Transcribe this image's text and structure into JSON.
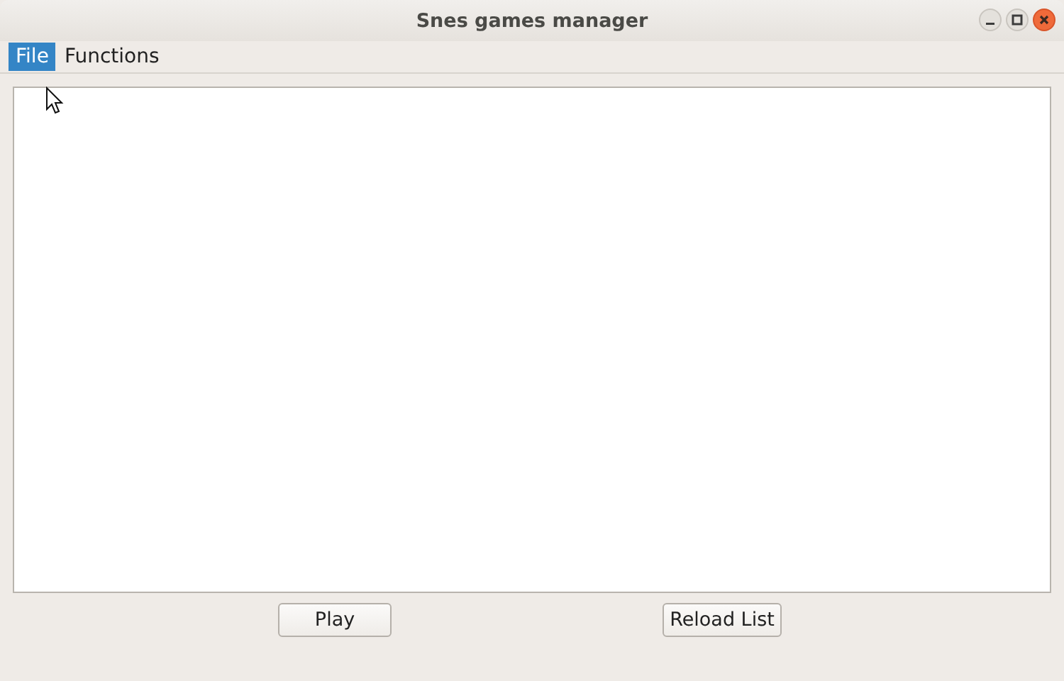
{
  "window": {
    "title": "Snes games manager"
  },
  "menu": [
    {
      "label": "File",
      "selected": true
    },
    {
      "label": "Functions",
      "selected": false
    }
  ],
  "buttons": [
    "Play",
    "Reload List"
  ]
}
